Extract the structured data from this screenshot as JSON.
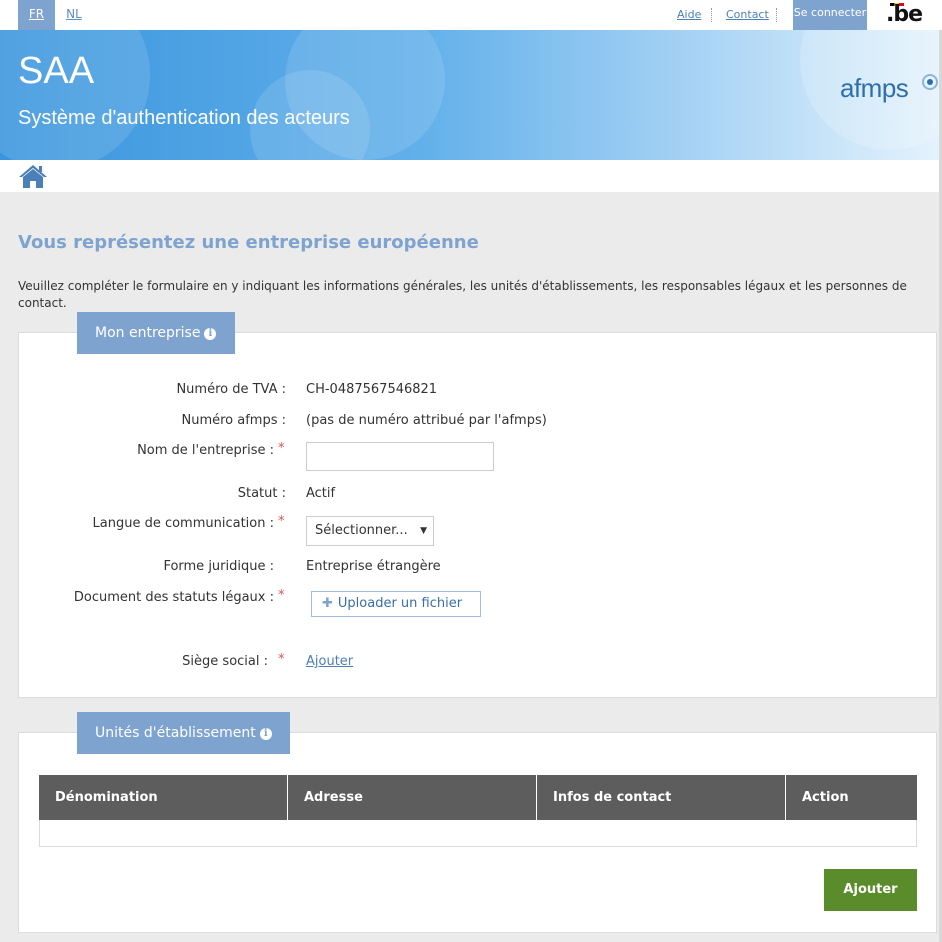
{
  "top": {
    "lang_fr": "FR",
    "lang_nl": "NL",
    "help": "Aide",
    "contact": "Contact",
    "login": "Se connecter",
    "be_logo": ".be"
  },
  "banner": {
    "title": "SAA",
    "subtitle": "Système d'authentication des acteurs",
    "logo": "afmps"
  },
  "page": {
    "title": "Vous représentez une entreprise européenne",
    "intro": "Veuillez compléter le formulaire en y indiquant les informations générales, les unités d'établissements, les responsables légaux et les personnes de contact."
  },
  "company": {
    "tab": "Mon entreprise",
    "vat_label": "Numéro de TVA :",
    "vat_value": "CH-0487567546821",
    "afmps_label": "Numéro afmps :",
    "afmps_value": "(pas de numéro attribué par l'afmps)",
    "name_label": "Nom de l'entreprise :",
    "name_value": "",
    "status_label": "Statut :",
    "status_value": "Actif",
    "lang_label": "Langue de communication :",
    "lang_value": "Sélectionner...",
    "legal_form_label": "Forme juridique :",
    "legal_form_value": "Entreprise étrangère",
    "doc_label": "Document des statuts légaux :",
    "upload_label": "Uploader un fichier",
    "seat_label": "Siège social :",
    "seat_action": "Ajouter",
    "required_mark": "*"
  },
  "units": {
    "tab": "Unités d'établissement",
    "columns": [
      "Dénomination",
      "Adresse",
      "Infos de contact",
      "Action"
    ],
    "add_button": "Ajouter"
  },
  "icons": [
    "home-icon",
    "info-icon",
    "plus-icon",
    "chevron-down-icon"
  ],
  "colors": {
    "accent": "#7ea3ce",
    "link": "#4a7fb8",
    "table_header": "#5d5d5d",
    "add_button": "#5b8c2b",
    "required": "#d9534f"
  }
}
